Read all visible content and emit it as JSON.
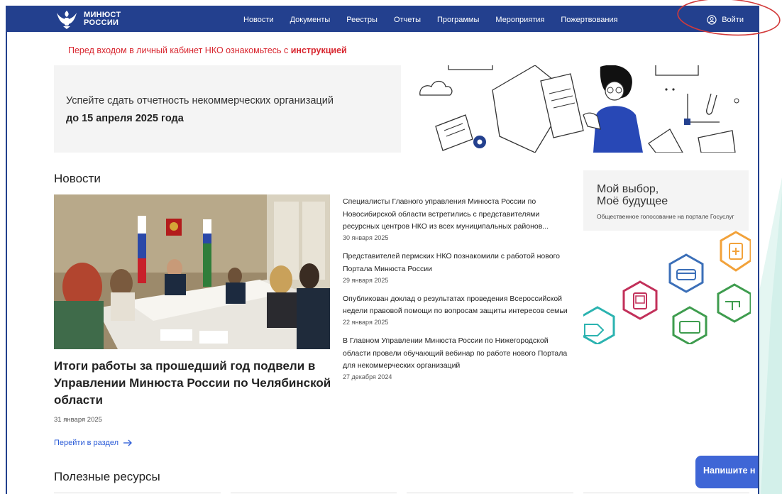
{
  "header": {
    "logo_line1": "МИНЮСТ",
    "logo_line2": "РОССИИ",
    "nav": [
      "Новости",
      "Документы",
      "Реестры",
      "Отчеты",
      "Программы",
      "Мероприятия",
      "Пожертвования"
    ],
    "login_label": "Войти",
    "background_color": "#23408e"
  },
  "notice": {
    "text": "Перед входом в личный кабинет НКО ознакомьтесь с ",
    "link": "инструкцией",
    "color": "#d8262f"
  },
  "banner": {
    "line1": "Успейте сдать отчетность некоммерческих организаций",
    "line2": "до 15 апреля 2025 года"
  },
  "news": {
    "heading": "Новости",
    "main": {
      "title": "Итоги работы за прошедший год подвели в Управлении Минюста России по Челябинской области",
      "date": "31 января 2025"
    },
    "items": [
      {
        "text": "Специалисты Главного управления Минюста России по Новосибирской области встретились с представителями ресурсных центров НКО из всех муниципальных районов...",
        "date": "30 января 2025"
      },
      {
        "text": "Представителей пермских НКО познакомили с работой нового Портала Минюста России",
        "date": "29 января 2025"
      },
      {
        "text": "Опубликован доклад о результатах проведения Всероссийской недели правовой помощи по вопросам защиты интересов семьи",
        "date": "22 января 2025"
      },
      {
        "text": "В Главном Управлении Минюста России по Нижегородской области провели обучающий вебинар по работе нового Портала для некоммерческих организаций",
        "date": "27 декабря 2024"
      }
    ],
    "section_link": "Перейти в раздел"
  },
  "promo": {
    "title_line1": "Мой выбор,",
    "title_line2": "Моё будущее",
    "subtitle": "Общественное голосование на портале Госуслуг"
  },
  "resources": {
    "heading": "Полезные ресурсы"
  },
  "chat": {
    "label": "Напишите н"
  },
  "icons": {
    "login": "user-circle-icon",
    "arrow": "arrow-right-icon",
    "emblem": "eagle-emblem-icon"
  },
  "colors": {
    "link": "#2a5bd7",
    "accent_red": "#d8262f",
    "chat": "#3f66d6"
  }
}
